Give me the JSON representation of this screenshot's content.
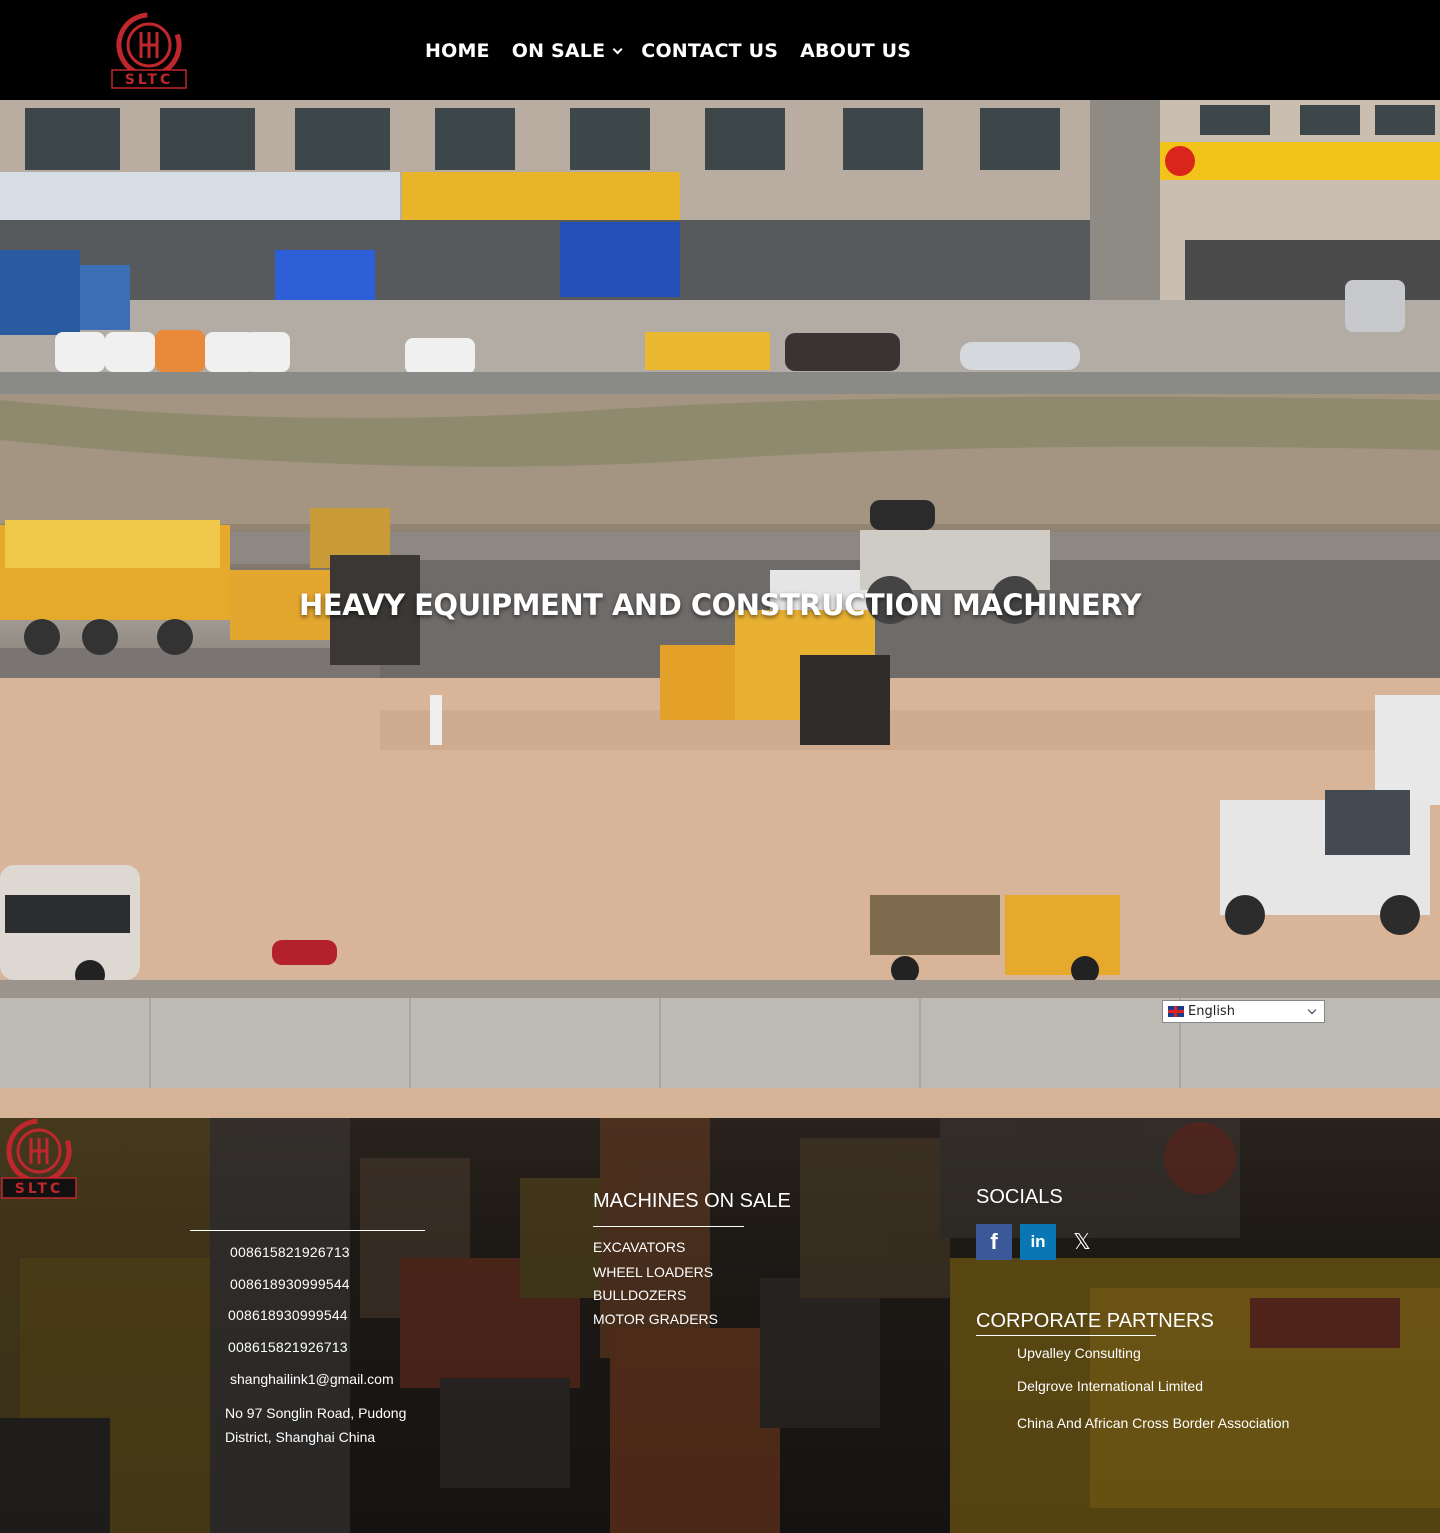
{
  "header": {
    "logo_text": "SLTC",
    "nav": [
      {
        "label": "HOME"
      },
      {
        "label": "ON SALE"
      },
      {
        "label": "CONTACT US"
      },
      {
        "label": "ABOUT US"
      }
    ]
  },
  "hero": {
    "title": "HEAVY EQUIPMENT AND CONSTRUCTION MACHINERY",
    "language_selector": "English"
  },
  "footer": {
    "logo_text": "SLTC",
    "contacts": {
      "phone1": "008615821926713",
      "phone2": "008618930999544",
      "phone3": "008618930999544",
      "phone4": "008615821926713",
      "email": "shanghailink1@gmail.com",
      "address_line1": "No 97 Songlin Road, Pudong",
      "address_line2": "District, Shanghai China"
    },
    "machines": {
      "heading": "MACHINES ON SALE",
      "links": [
        "EXCAVATORS",
        "WHEEL LOADERS",
        "BULLDOZERS",
        "MOTOR GRADERS"
      ]
    },
    "socials": {
      "heading": "SOCIALS",
      "icons": [
        "facebook-icon",
        "linkedin-icon",
        "x-icon"
      ]
    },
    "partners": {
      "heading": "CORPORATE PARTNERS",
      "links": [
        "Upvalley Consulting",
        "Delgrove International Limited",
        "China And African Cross Border Association"
      ]
    }
  },
  "colors": {
    "brand_red": "#c0272d",
    "header_bg": "#000000",
    "facebook": "#3b5998",
    "linkedin": "#0a77b5"
  }
}
